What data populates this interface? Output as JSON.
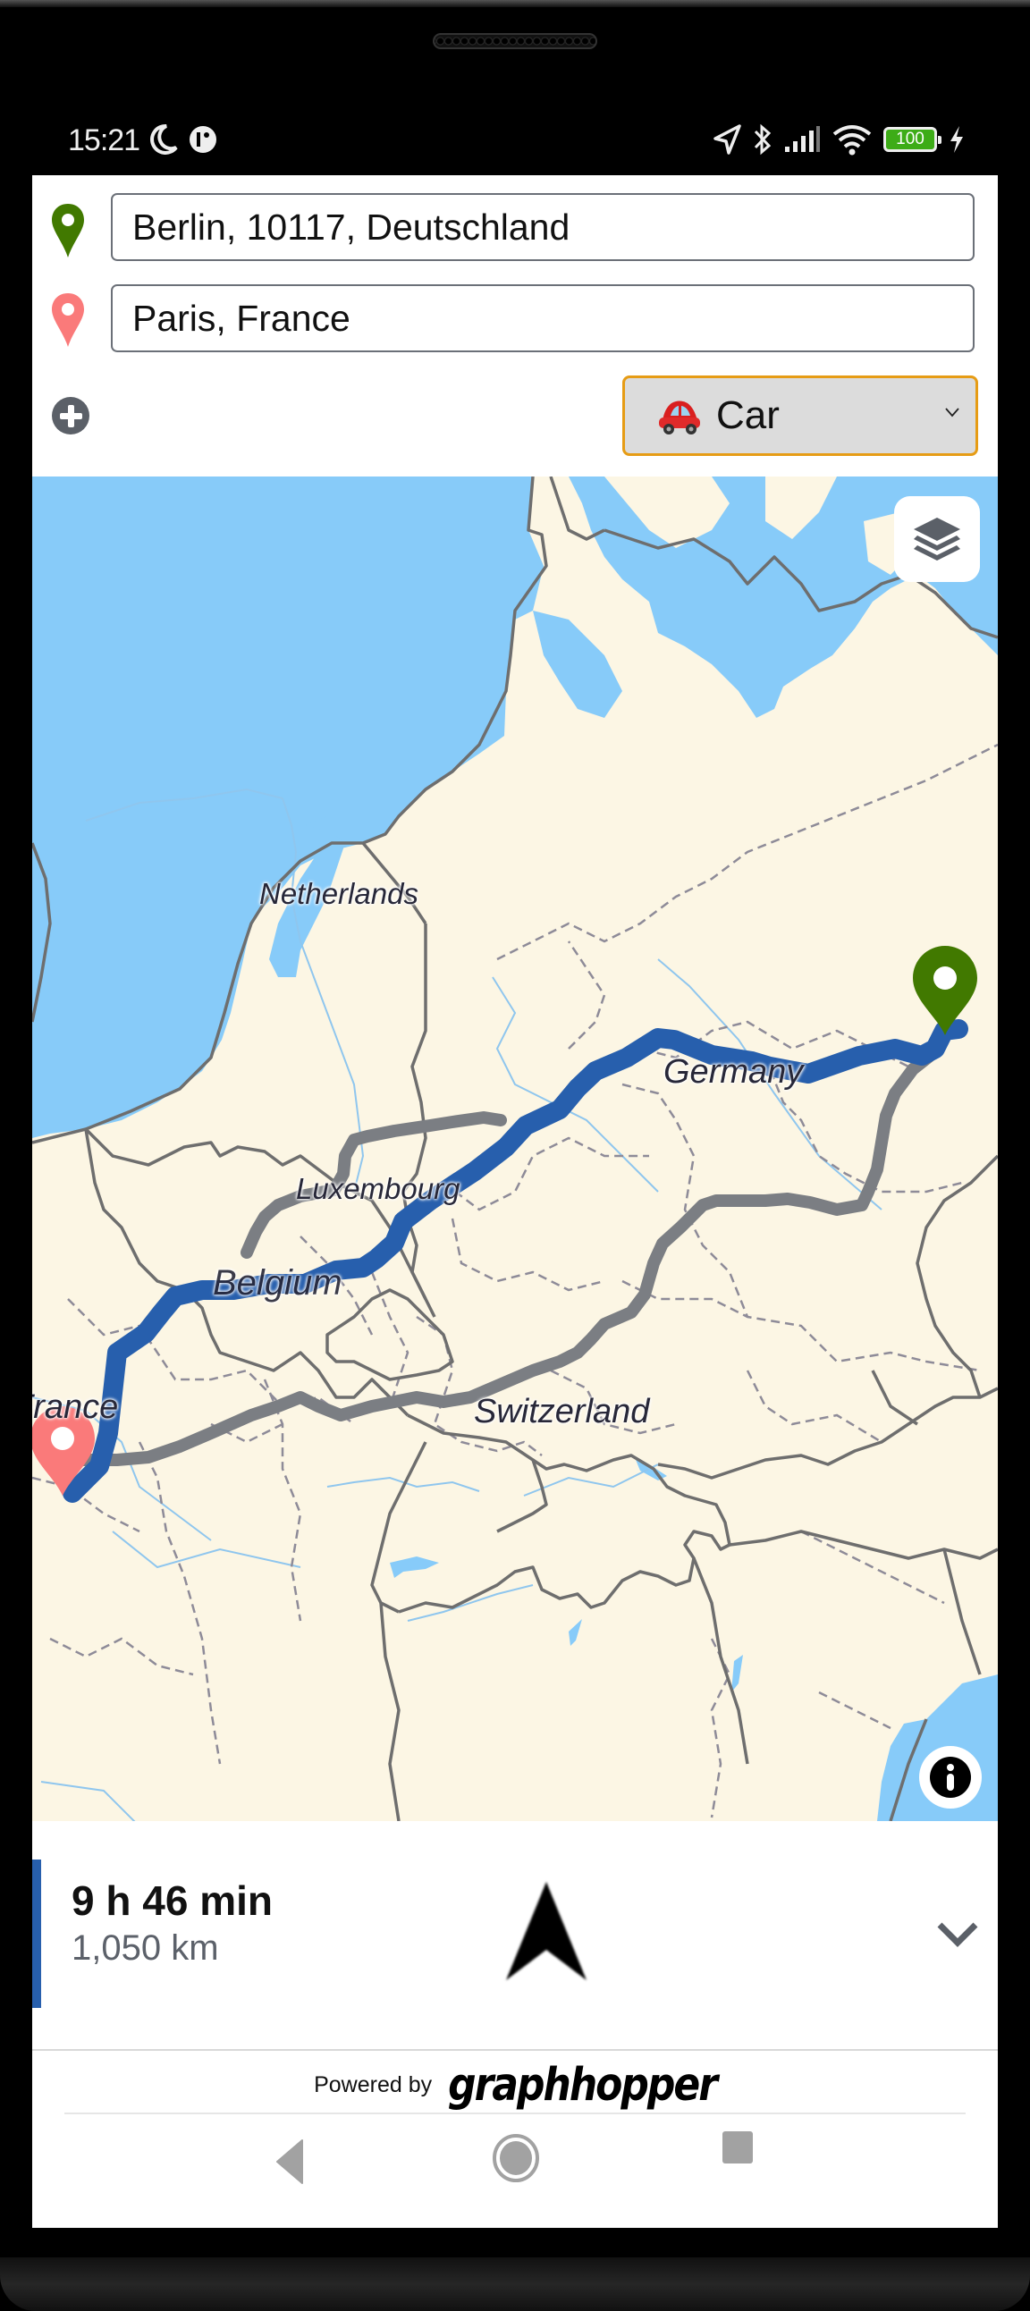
{
  "status_bar": {
    "time": "15:21",
    "left_icons": [
      "moon-icon",
      "app-notification-icon"
    ],
    "right_icons": [
      "location-arrow-icon",
      "bluetooth-icon",
      "signal-icon",
      "wifi-icon",
      "battery-icon",
      "charging-icon"
    ],
    "battery_level": "100"
  },
  "search": {
    "start": {
      "value": "Berlin, 10117, Deutschland",
      "pin_color": "#417900"
    },
    "end": {
      "value": "Paris, France",
      "pin_color": "#fa7a7a"
    },
    "add_point_icon": "plus-circle-icon",
    "vehicle": {
      "selected": "Car",
      "emoji": "car-emoji",
      "border_color": "#e69c15"
    }
  },
  "map": {
    "labels": {
      "netherlands": "Netherlands",
      "belgium": "Belgium",
      "luxembourg": "Luxembourg",
      "germany": "Germany",
      "switzerland": "Switzerland",
      "france": "France"
    },
    "colors": {
      "land": "#fcf6e4",
      "water": "#87cbf9",
      "route_main": "#275fad",
      "route_alternative": "#7b7e83",
      "border": "#6e6e6e"
    },
    "controls": {
      "layers": "layers-icon",
      "info": "info-icon"
    }
  },
  "route": {
    "duration": "9 h 46 min",
    "distance": "1,050 km"
  },
  "footer": {
    "powered_by": "Powered by",
    "brand": "graphhopper"
  },
  "android_nav": {
    "back": "back-icon",
    "home": "home-icon",
    "recents": "recents-icon"
  }
}
